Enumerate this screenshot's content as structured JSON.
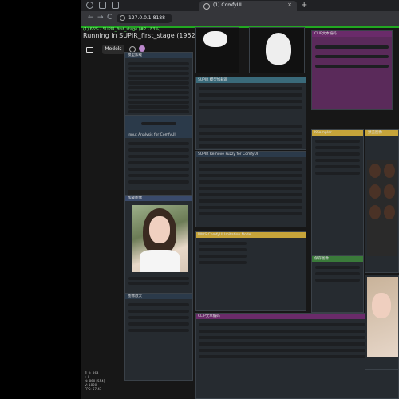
{
  "browser": {
    "tab_title": "(1) ComfyUI",
    "new_tab": "+",
    "close": "×",
    "url": "127.0.0.1:8188",
    "back": "←",
    "forward": "→",
    "reload": "C"
  },
  "comfy": {
    "status": "(1) 66% - SUPIR_first_stage (#2 - 83%)",
    "running": "Running in SUPIR_first_stage (1952)",
    "models_label": "Models",
    "coords": [
      "T: 0: 864",
      "I: 0",
      "N: 860 [554]",
      "V: 1820",
      "FPS: 57.47"
    ]
  },
  "nodes": [
    {
      "id": "n1",
      "title": "模型加载",
      "color": "#2b3a4a"
    },
    {
      "id": "n2",
      "title": "Input Analysis for ComfyUI",
      "color": "#2b3a4a"
    },
    {
      "id": "n3",
      "title": "加载图像",
      "color": "#3a4a6a"
    },
    {
      "id": "n4",
      "title": "图像放大",
      "color": "#2b3a4a"
    },
    {
      "id": "n5",
      "title": "SUPIR 模型加载器",
      "color": "#3a6a7a"
    },
    {
      "id": "n6",
      "title": "SUPIR Remove Fuzzy for ComfyUI",
      "color": "#2b3a4a"
    },
    {
      "id": "n7",
      "title": "MWS ComfyUI Imitation Node",
      "color": "#c6a43a"
    },
    {
      "id": "n8",
      "title": "输出设置",
      "color": "#2b5a3a"
    },
    {
      "id": "n9",
      "title": "CLIP文本编码",
      "color": "#6a2b6a"
    },
    {
      "id": "n10",
      "title": "KSampler",
      "color": "#c6a43a"
    },
    {
      "id": "n11",
      "title": "预览图像",
      "color": "#c6a43a"
    },
    {
      "id": "n12",
      "title": "保存图像",
      "color": "#3a7a3a"
    }
  ]
}
